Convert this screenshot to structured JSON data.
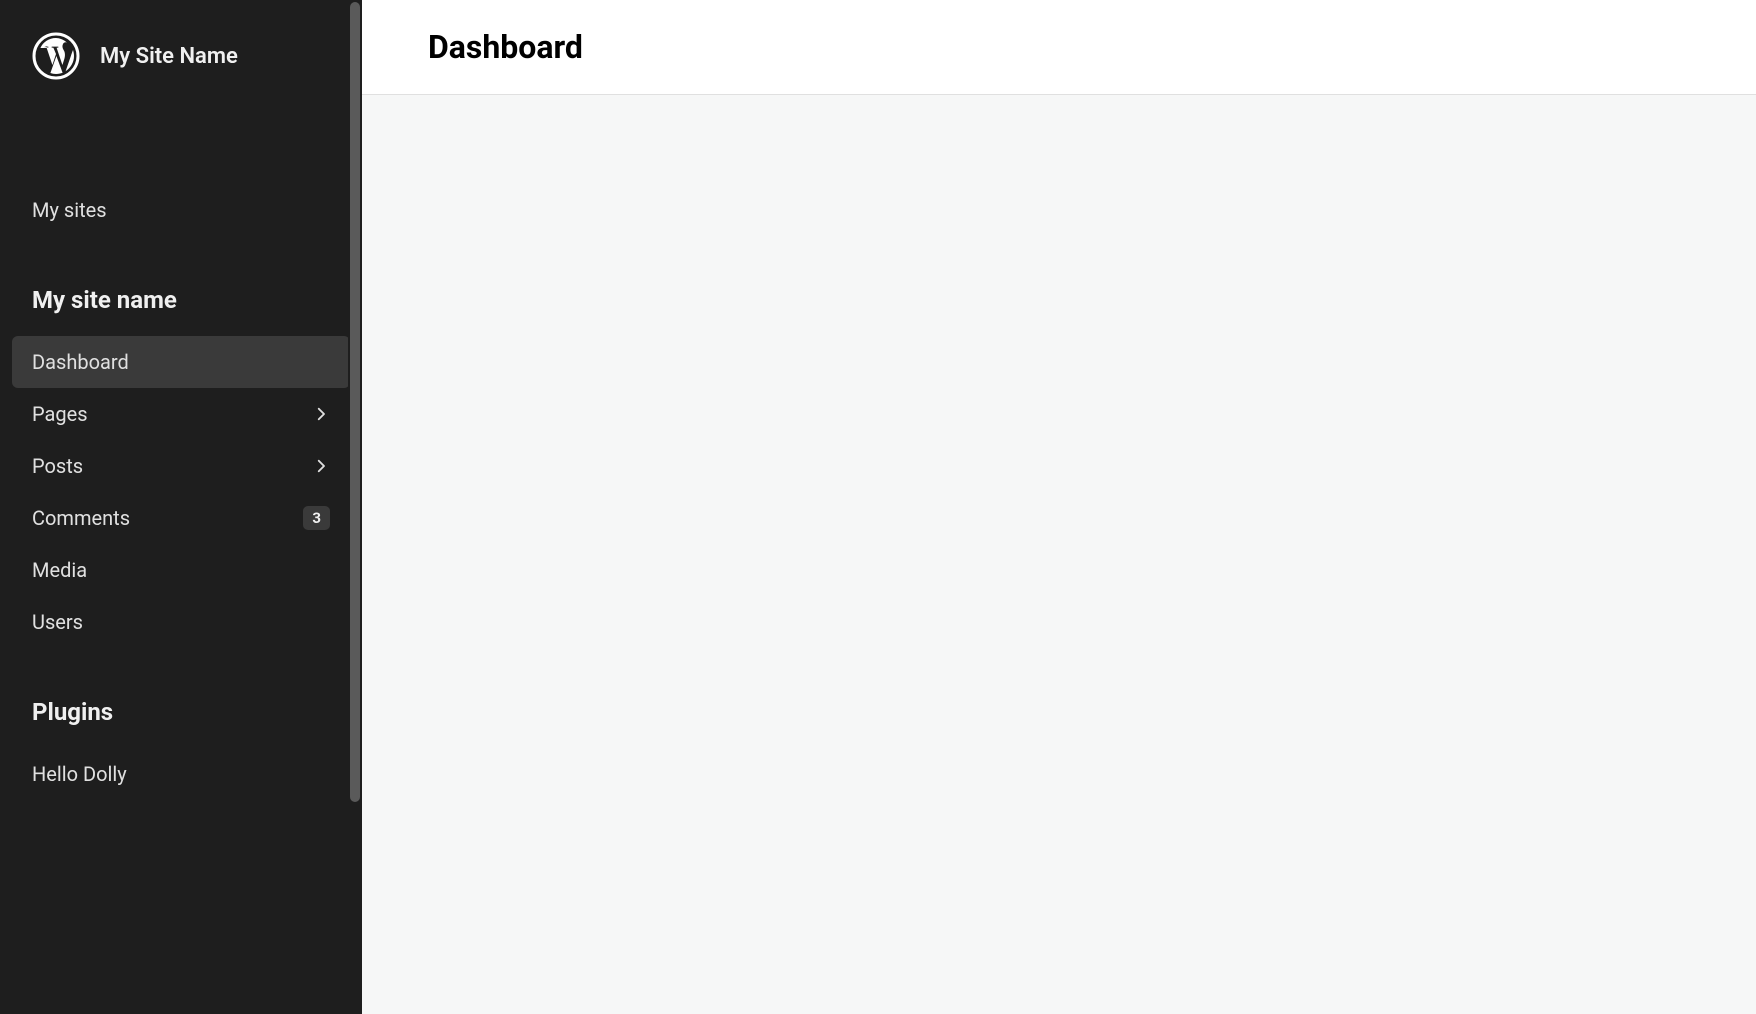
{
  "site": {
    "title": "My Site Name"
  },
  "sidebar": {
    "my_sites_label": "My sites",
    "site_name_heading": "My site name",
    "items": {
      "dashboard": {
        "label": "Dashboard"
      },
      "pages": {
        "label": "Pages"
      },
      "posts": {
        "label": "Posts"
      },
      "comments": {
        "label": "Comments",
        "badge": "3"
      },
      "media": {
        "label": "Media"
      },
      "users": {
        "label": "Users"
      }
    },
    "plugins_heading": "Plugins",
    "plugins": {
      "hello_dolly": {
        "label": "Hello Dolly"
      }
    }
  },
  "main": {
    "page_title": "Dashboard"
  }
}
